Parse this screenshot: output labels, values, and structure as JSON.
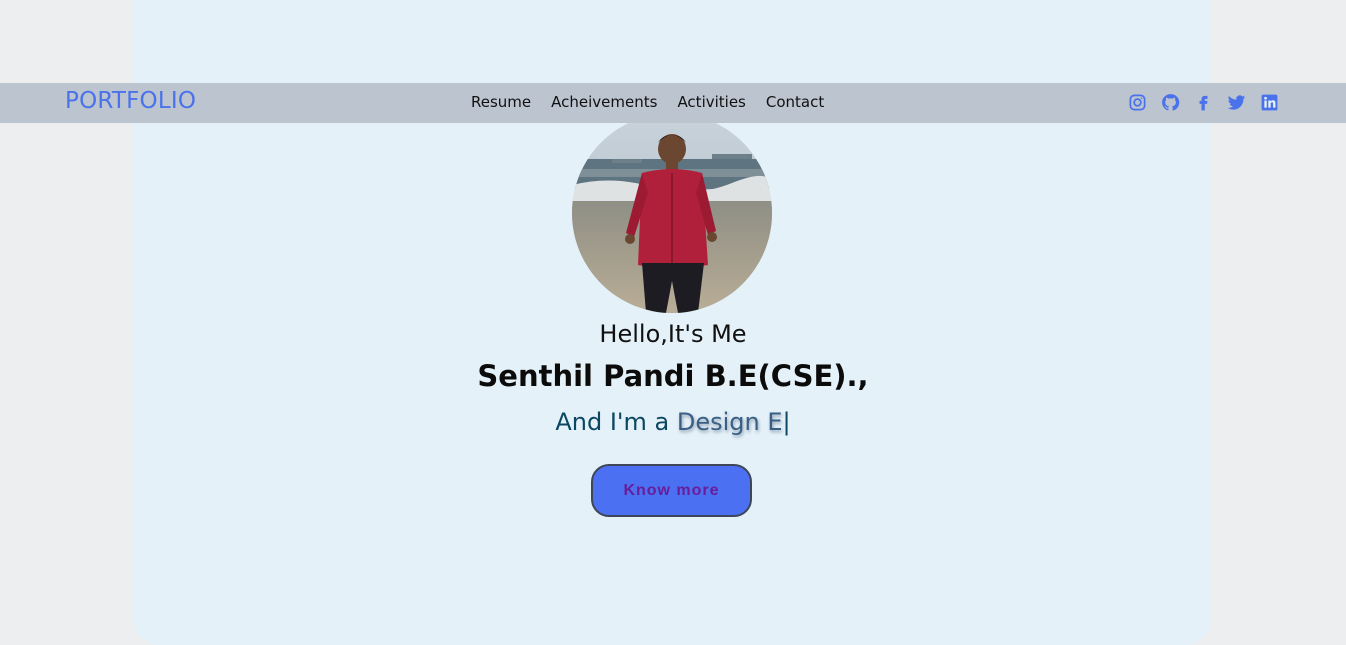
{
  "brand": {
    "logo": "PORTFOLIO",
    "accent": "#4a72ea"
  },
  "nav": {
    "items": [
      {
        "label": "Resume"
      },
      {
        "label": "Acheivements"
      },
      {
        "label": "Activities"
      },
      {
        "label": "Contact"
      }
    ]
  },
  "social": {
    "icons": [
      "instagram-icon",
      "github-icon",
      "facebook-icon",
      "twitter-icon",
      "linkedin-icon"
    ]
  },
  "hero": {
    "greeting": "Hello,It's Me",
    "name": "Senthil Pandi B.E(CSE).,",
    "role_prefix": "And I'm a ",
    "role_typed": "Design E",
    "cursor": "|",
    "cta_label": "Know more",
    "avatar_alt": "profile photo"
  },
  "colors": {
    "navbar": "#bcc4d0",
    "card": "#e4f1f9",
    "button": "#4b70f2",
    "button_text": "#6a1d9a"
  }
}
